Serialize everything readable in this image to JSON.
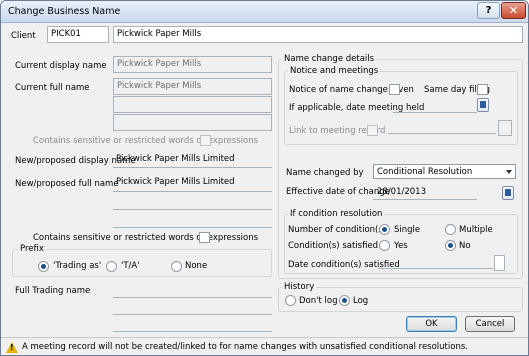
{
  "window": {
    "title": "Change Business Name",
    "help_label": "?",
    "close_label": "✕"
  },
  "client": {
    "label": "Client",
    "code": "PICK01",
    "name": "Pickwick Paper Mills"
  },
  "left": {
    "current_display_label": "Current display name",
    "current_display_value": "Pickwick Paper Mills",
    "current_full_label": "Current full name",
    "current_full_value": "Pickwick Paper Mills",
    "sensitive_label_1": "Contains sensitive or restricted words or expressions",
    "new_display_label": "New/proposed display name",
    "new_display_value": "Pickwick Paper Mills Limited",
    "new_full_label": "New/proposed full name",
    "new_full_value": "Pickwick Paper Mills Limited",
    "sensitive_label_2": "Contains sensitive or restricted words or expressions",
    "prefix_label": "Prefix",
    "prefix_options": [
      "'Trading as'",
      "'T/A'",
      "None"
    ],
    "full_trading_label": "Full Trading name"
  },
  "right": {
    "group_title": "Name change details",
    "notice_title": "Notice and meetings",
    "notice_given_label": "Notice of name change given",
    "same_day_label": "Same day filing",
    "meeting_date_label": "If applicable, date meeting held",
    "link_meeting_label": "Link to meeting record",
    "changed_by_label": "Name changed by",
    "changed_by_value": "Conditional Resolution",
    "effective_date_label": "Effective date of change",
    "effective_date_value": "28/01/2013",
    "condition_title": "If condition resolution",
    "num_conditions_label": "Number of condition(s)",
    "num_options": [
      "Single",
      "Multiple"
    ],
    "satisfied_label": "Condition(s) satisfied",
    "satisfied_options": [
      "Yes",
      "No"
    ],
    "date_satisfied_label": "Date condition(s) satisfied"
  },
  "history": {
    "title": "History",
    "options": [
      "Don't log",
      "Log"
    ]
  },
  "buttons": {
    "ok": "OK",
    "cancel": "Cancel"
  },
  "status": {
    "message": "A meeting record will not be created/linked to for name changes with unsatisfied conditional resolutions."
  }
}
